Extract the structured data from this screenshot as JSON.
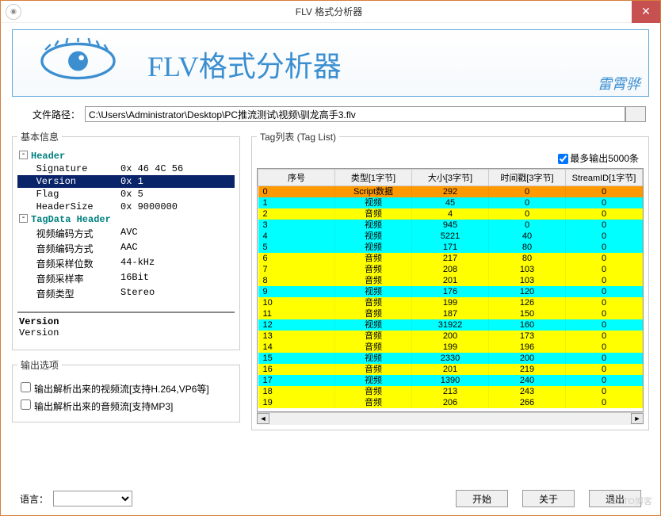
{
  "window": {
    "title": "FLV 格式分析器"
  },
  "banner": {
    "title": "FLV格式分析器",
    "author": "雷霄骅"
  },
  "file": {
    "label": "文件路径：",
    "path": "C:\\Users\\Administrator\\Desktop\\PC推流测试\\视频\\驯龙高手3.flv"
  },
  "basicInfo": {
    "legend": "基本信息",
    "headerLabel": "Header",
    "tagDataLabel": "TagData Header",
    "rows": [
      {
        "k": "Signature",
        "v": "0x 46 4C 56",
        "indent": "   "
      },
      {
        "k": "Version",
        "v": "0x 1",
        "indent": "   ",
        "selected": true
      },
      {
        "k": "Flag",
        "v": "0x 5",
        "indent": "   "
      },
      {
        "k": "HeaderSize",
        "v": "0x 9000000",
        "indent": "   "
      }
    ],
    "tagRows": [
      {
        "k": "视频编码方式",
        "v": "AVC",
        "indent": "   "
      },
      {
        "k": "音频编码方式",
        "v": "AAC",
        "indent": "   "
      },
      {
        "k": "音频采样位数",
        "v": "44-kHz",
        "indent": "   "
      },
      {
        "k": "音频采样率",
        "v": "16Bit",
        "indent": "   "
      },
      {
        "k": "音频类型",
        "v": "Stereo",
        "indent": "   "
      }
    ],
    "descTitle": "Version",
    "descBody": "Version"
  },
  "output": {
    "legend": "输出选项",
    "opt1": "输出解析出来的视频流[支持H.264,VP6等]",
    "opt2": "输出解析出来的音频流[支持MP3]"
  },
  "tagList": {
    "legend": "Tag列表 (Tag List)",
    "maxOutLabel": "最多输出5000条",
    "maxOutChecked": true,
    "columns": [
      "序号",
      "类型[1字节]",
      "大小[3字节]",
      "时间戳[3字节]",
      "StreamID[1字节]"
    ],
    "rows": [
      {
        "n": 0,
        "type": "Script数据",
        "size": 292,
        "ts": 0,
        "sid": 0,
        "cls": "script"
      },
      {
        "n": 1,
        "type": "视频",
        "size": 45,
        "ts": 0,
        "sid": 0,
        "cls": "video"
      },
      {
        "n": 2,
        "type": "音频",
        "size": 4,
        "ts": 0,
        "sid": 0,
        "cls": "audio"
      },
      {
        "n": 3,
        "type": "视频",
        "size": 945,
        "ts": 0,
        "sid": 0,
        "cls": "video"
      },
      {
        "n": 4,
        "type": "视频",
        "size": 5221,
        "ts": 40,
        "sid": 0,
        "cls": "video"
      },
      {
        "n": 5,
        "type": "视频",
        "size": 171,
        "ts": 80,
        "sid": 0,
        "cls": "video"
      },
      {
        "n": 6,
        "type": "音频",
        "size": 217,
        "ts": 80,
        "sid": 0,
        "cls": "audio"
      },
      {
        "n": 7,
        "type": "音频",
        "size": 208,
        "ts": 103,
        "sid": 0,
        "cls": "audio"
      },
      {
        "n": 8,
        "type": "音频",
        "size": 201,
        "ts": 103,
        "sid": 0,
        "cls": "audio"
      },
      {
        "n": 9,
        "type": "视频",
        "size": 176,
        "ts": 120,
        "sid": 0,
        "cls": "video"
      },
      {
        "n": 10,
        "type": "音频",
        "size": 199,
        "ts": 126,
        "sid": 0,
        "cls": "audio"
      },
      {
        "n": 11,
        "type": "音频",
        "size": 187,
        "ts": 150,
        "sid": 0,
        "cls": "audio"
      },
      {
        "n": 12,
        "type": "视频",
        "size": 31922,
        "ts": 160,
        "sid": 0,
        "cls": "video"
      },
      {
        "n": 13,
        "type": "音频",
        "size": 200,
        "ts": 173,
        "sid": 0,
        "cls": "audio"
      },
      {
        "n": 14,
        "type": "音频",
        "size": 199,
        "ts": 196,
        "sid": 0,
        "cls": "audio"
      },
      {
        "n": 15,
        "type": "视频",
        "size": 2330,
        "ts": 200,
        "sid": 0,
        "cls": "video"
      },
      {
        "n": 16,
        "type": "音频",
        "size": 201,
        "ts": 219,
        "sid": 0,
        "cls": "audio"
      },
      {
        "n": 17,
        "type": "视频",
        "size": 1390,
        "ts": 240,
        "sid": 0,
        "cls": "video"
      },
      {
        "n": 18,
        "type": "音频",
        "size": 213,
        "ts": 243,
        "sid": 0,
        "cls": "audio"
      },
      {
        "n": 19,
        "type": "音频",
        "size": 206,
        "ts": 266,
        "sid": 0,
        "cls": "audio"
      }
    ]
  },
  "footer": {
    "langLabel": "语言：",
    "start": "开始",
    "about": "关于",
    "exit": "退出"
  },
  "watermark": "51CTO博客"
}
